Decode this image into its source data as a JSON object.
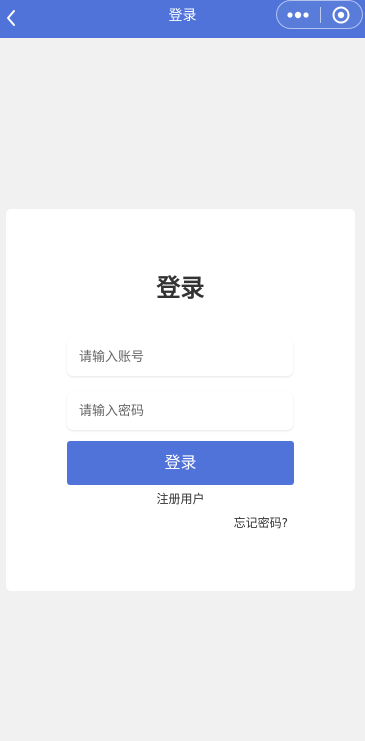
{
  "nav": {
    "title": "登录",
    "back_icon": "chevron-left-icon",
    "more_icon": "more-dots-icon",
    "close_icon": "target-close-icon"
  },
  "form": {
    "heading": "登录",
    "account_placeholder": "请输入账号",
    "account_value": "",
    "password_placeholder": "请输入密码",
    "password_value": "",
    "submit_label": "登录",
    "register_label": "注册用户",
    "forgot_label": "忘记密码?"
  },
  "colors": {
    "brand": "#4f73d8",
    "background": "#f1f1f1",
    "card": "#ffffff",
    "text": "#333333"
  }
}
